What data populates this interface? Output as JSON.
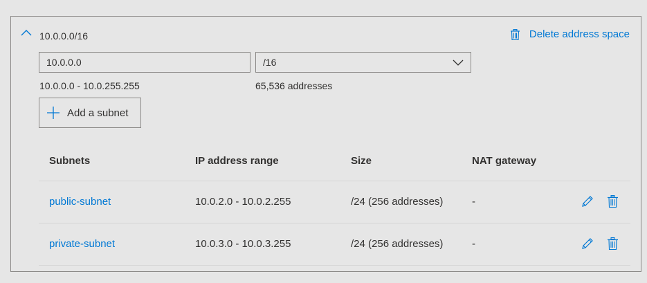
{
  "address_space": {
    "title": "10.0.0.0/16",
    "delete_label": "Delete address space",
    "address_value": "10.0.0.0",
    "prefix_selected": "/16",
    "range_text": "10.0.0.0 - 10.0.255.255",
    "count_text": "65,536 addresses",
    "add_subnet_label": "Add a subnet"
  },
  "subnets_table": {
    "columns": [
      "Subnets",
      "IP address range",
      "Size",
      "NAT gateway"
    ],
    "rows": [
      {
        "name": "public-subnet",
        "range": "10.0.2.0 - 10.0.2.255",
        "size": "/24 (256 addresses)",
        "nat": "-"
      },
      {
        "name": "private-subnet",
        "range": "10.0.3.0 - 10.0.3.255",
        "size": "/24 (256 addresses)",
        "nat": "-"
      }
    ]
  },
  "colors": {
    "accent": "#0078d4",
    "text": "#323130",
    "border": "#8a8886",
    "background": "#e6e6e6"
  },
  "icons": {
    "collapse": "chevron-up-icon",
    "delete": "trash-icon",
    "dropdown": "chevron-down-icon",
    "add": "plus-icon",
    "edit": "pencil-icon"
  }
}
